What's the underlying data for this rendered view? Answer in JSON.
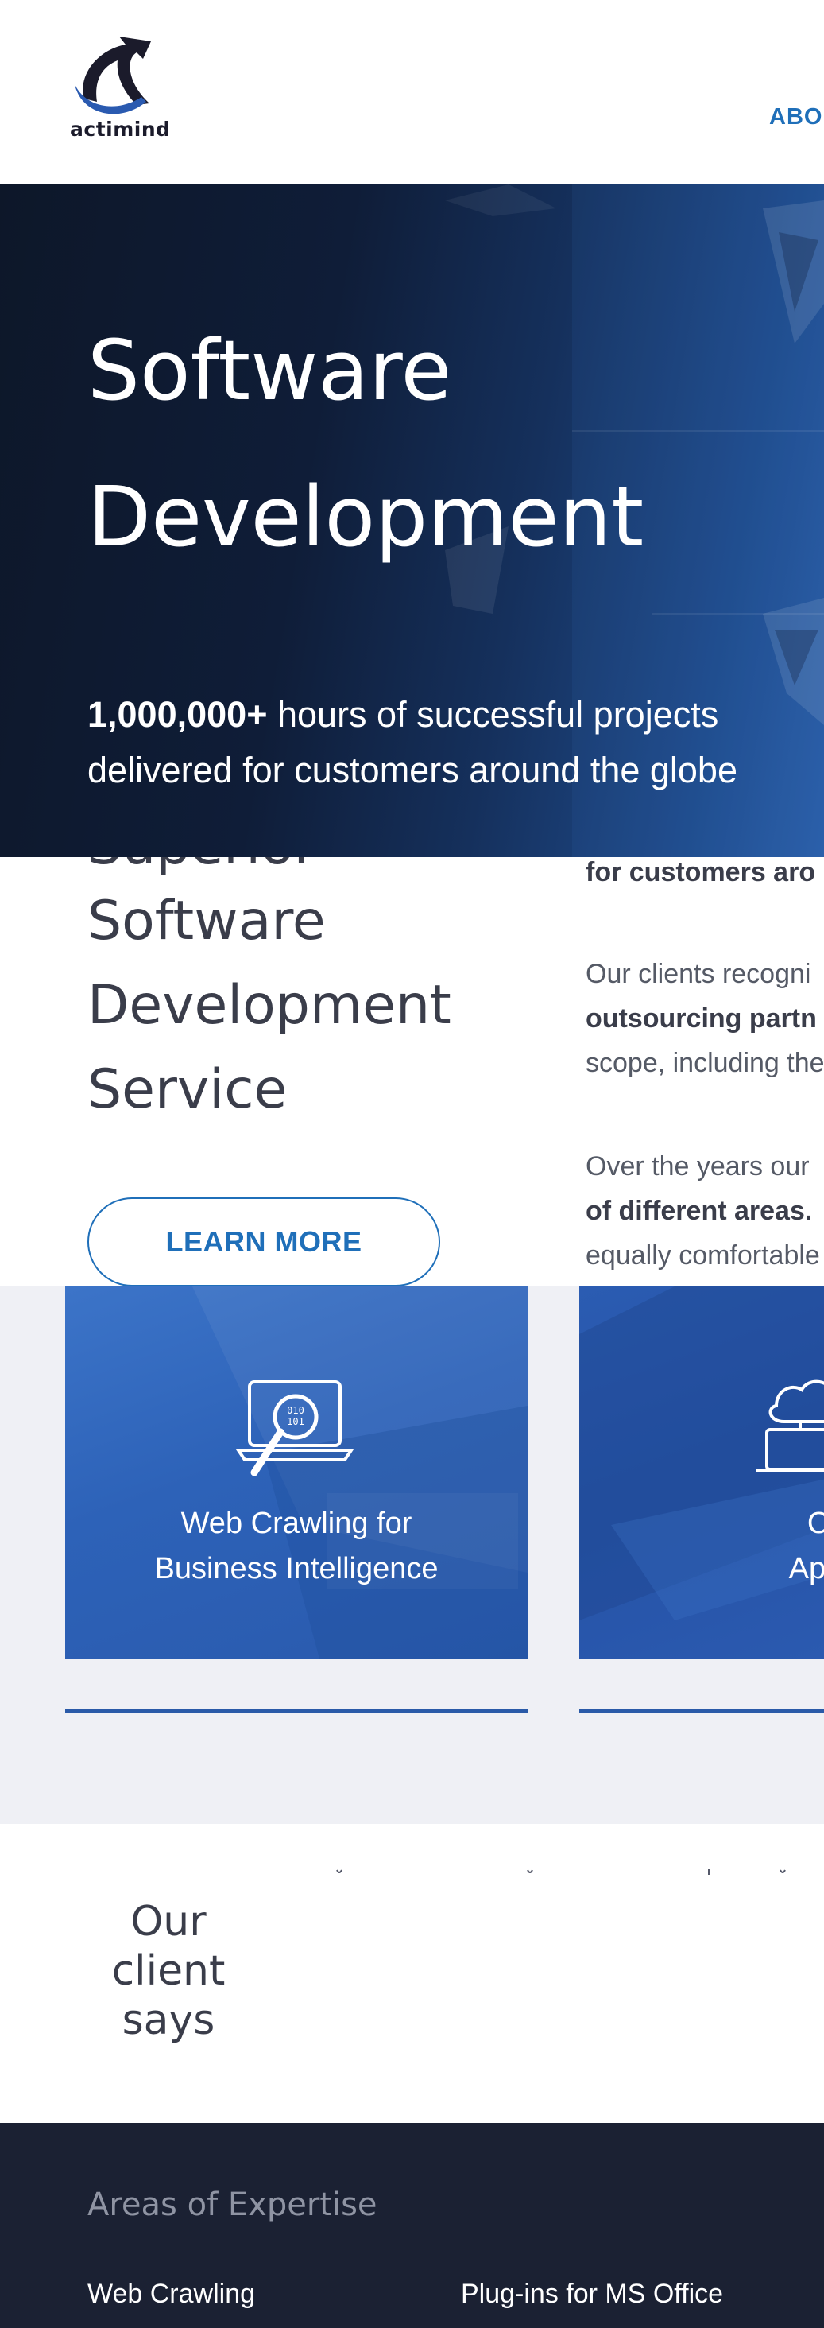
{
  "header": {
    "logo_text": "actimind",
    "nav": {
      "about_label": "ABO"
    }
  },
  "hero": {
    "title_line1": "Software",
    "title_line2": "Development",
    "subtitle_bold": "1,000,000+",
    "subtitle_rest": " hours of successful projects delivered for customers around the globe"
  },
  "service": {
    "heading_lines": [
      "Superior",
      "Software",
      "Development",
      "Service"
    ],
    "learn_more_label": "LEARN MORE",
    "paragraph1_bold": "for customers aro",
    "paragraph2": {
      "line1": "Our clients recogni",
      "line2_bold": "outsourcing partn",
      "line3": "scope, including the"
    },
    "paragraph3": {
      "line1": "Over the years our",
      "line2_bold": "of different areas.",
      "line3": "equally comfortable"
    }
  },
  "cards": [
    {
      "title_line1": "Web Crawling for",
      "title_line2": "Business Intelligence",
      "icon": "laptop-search-icon",
      "binary_top": "010",
      "binary_bottom": "101"
    },
    {
      "title_line1": "Clou",
      "title_line2": "Applica",
      "icon": "cloud-laptop-icon"
    }
  ],
  "testimonial": {
    "title": "Our client says"
  },
  "footer": {
    "heading": "Areas of Expertise",
    "links": [
      "Web Crawling",
      "Plug-ins for MS Office"
    ]
  },
  "colors": {
    "brand_blue": "#1f6fb9",
    "hero_dark": "#0d1729",
    "card_blue": "#2d62b8",
    "footer_bg": "#1b2133"
  }
}
